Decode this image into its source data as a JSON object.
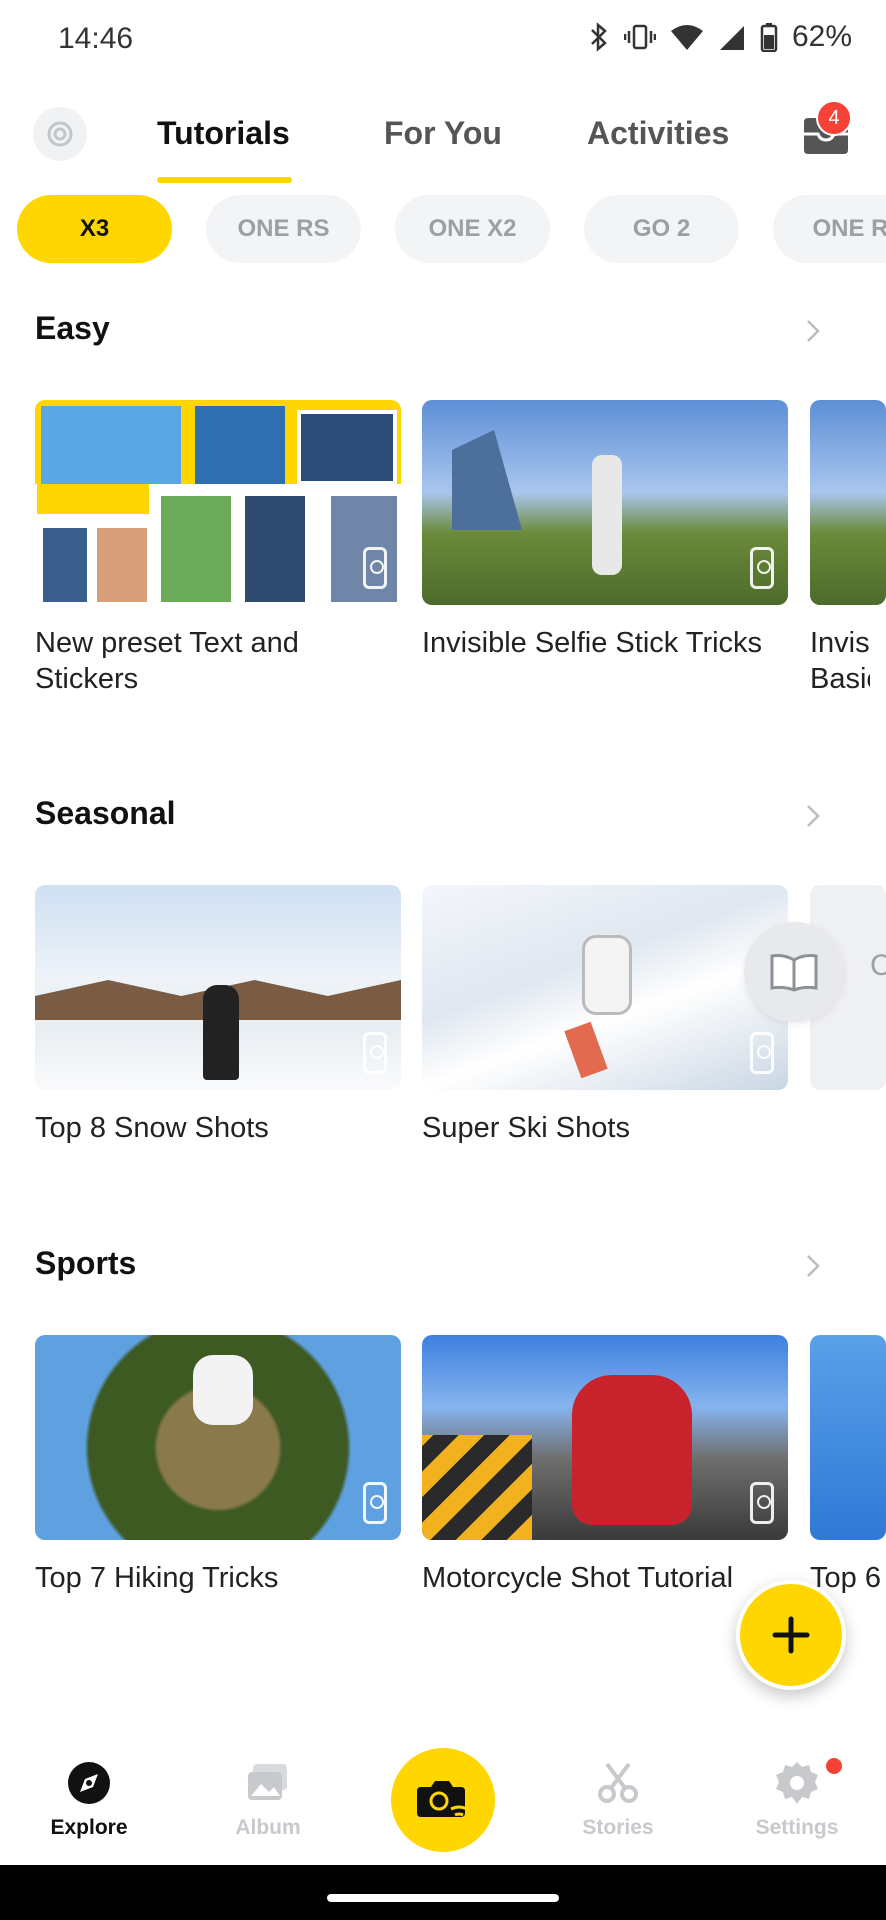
{
  "status_bar": {
    "time": "14:46",
    "battery": "62%",
    "icons": [
      "bluetooth-icon",
      "vibrate-icon",
      "wifi-icon",
      "signal-icon",
      "battery-icon"
    ]
  },
  "top_nav": {
    "tabs": [
      {
        "label": "Tutorials",
        "active": true
      },
      {
        "label": "For You",
        "active": false
      },
      {
        "label": "Activities",
        "active": false
      }
    ],
    "inbox_badge": "4"
  },
  "chips": [
    {
      "label": "X3",
      "active": true
    },
    {
      "label": "ONE RS",
      "active": false
    },
    {
      "label": "ONE X2",
      "active": false
    },
    {
      "label": "GO 2",
      "active": false
    },
    {
      "label": "ONE R",
      "active": false
    }
  ],
  "sections": [
    {
      "title": "Easy",
      "cards": [
        {
          "title": "New preset Text and Stickers",
          "thumb": "collage"
        },
        {
          "title": "Invisible Selfie Stick Tricks",
          "thumb": "sky"
        },
        {
          "title": "Invisib Basic",
          "thumb": "sky"
        }
      ]
    },
    {
      "title": "Seasonal",
      "cards": [
        {
          "title": "Top 8 Snow Shots",
          "thumb": "snow1"
        },
        {
          "title": "Super Ski Shots",
          "thumb": "snow2"
        },
        {
          "title": "C Mo",
          "thumb": "grey-peek"
        }
      ]
    },
    {
      "title": "Sports",
      "cards": [
        {
          "title": "Top 7 Hiking Tricks",
          "thumb": "forest"
        },
        {
          "title": "Motorcycle Shot Tutorial",
          "thumb": "road"
        },
        {
          "title": "Top 6",
          "thumb": "blue-peek"
        }
      ]
    }
  ],
  "bottom_nav": [
    {
      "label": "Explore",
      "icon": "compass-icon",
      "active": true
    },
    {
      "label": "Album",
      "icon": "album-icon",
      "active": false
    },
    {
      "label": "Stories",
      "icon": "scissors-icon",
      "active": false
    },
    {
      "label": "Settings",
      "icon": "gear-icon",
      "active": false
    }
  ],
  "colors": {
    "accent": "#ffd600",
    "badge": "#f44336",
    "inactive": "#c7c9cc"
  }
}
